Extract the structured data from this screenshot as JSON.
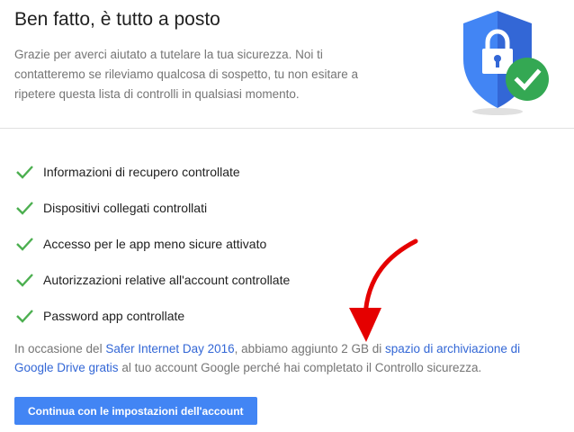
{
  "header": {
    "title": "Ben fatto, è tutto a posto",
    "intro": "Grazie per averci aiutato a tutelare la tua sicurezza. Noi ti contatteremo se rileviamo qualcosa di sospetto, tu non esitare a ripetere questa lista di controlli in qualsiasi momento."
  },
  "checklist": [
    {
      "label": "Informazioni di recupero controllate"
    },
    {
      "label": "Dispositivi collegati controllati"
    },
    {
      "label": "Accesso per le app meno sicure attivato"
    },
    {
      "label": "Autorizzazioni relative all'account controllate"
    },
    {
      "label": "Password app controllate"
    }
  ],
  "note": {
    "part1": "In occasione del ",
    "link1": "Safer Internet Day 2016",
    "part2": ", abbiamo aggiunto 2 GB di ",
    "link2": "spazio di archiviazione di Google Drive gratis",
    "part3": " al tuo account Google perché hai completato il Controllo sicurezza."
  },
  "cta": {
    "label": "Continua con le impostazioni dell'account"
  },
  "colors": {
    "check": "#4caf50",
    "shield": "#4285f4",
    "shield_dark": "#3367d6",
    "badge": "#34a853",
    "link": "#3367d6",
    "button": "#4285f4",
    "annotation_arrow": "#e50000"
  },
  "icons": {
    "shield": "shield-lock-icon",
    "badge": "check-badge-icon",
    "check": "checkmark-icon",
    "arrow": "red-arrow-annotation"
  }
}
